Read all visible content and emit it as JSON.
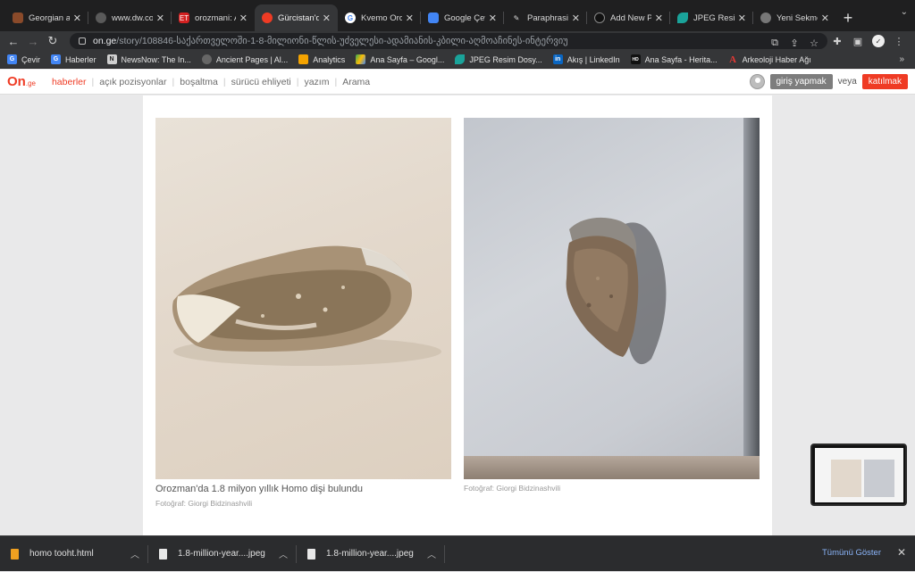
{
  "tabs": [
    {
      "title": "Georgian ar",
      "favicon_color": "#8a4a2a",
      "active": false
    },
    {
      "title": "www.dw.co",
      "favicon_color": "#5a5a5a",
      "active": false
    },
    {
      "title": "orozmani: A",
      "favicon_color": "#d32020",
      "favicon_text": "ET",
      "active": false
    },
    {
      "title": "Gürcistan'd",
      "favicon_color": "#ef3b24",
      "active": true
    },
    {
      "title": "Kvemo Oroz",
      "favicon_color": "#4285f4",
      "favicon_text": "G",
      "active": false
    },
    {
      "title": "Google Çevi",
      "favicon_color": "#4285f4",
      "active": false
    },
    {
      "title": "Paraphrasin",
      "favicon_color": "#444",
      "active": false
    },
    {
      "title": "Add New Po",
      "favicon_color": "#111",
      "active": false
    },
    {
      "title": "JPEG Resim",
      "favicon_color": "#1aa39a",
      "active": false
    },
    {
      "title": "Yeni Sekme",
      "favicon_color": "#666",
      "active": false
    }
  ],
  "address": {
    "host": "on.ge",
    "path": "/story/108846-საქართველოში-1-8-მილიონი-წლის-უძველესი-ადამიანის-კბილი-აღმოაჩინეს-ინტერვიუ"
  },
  "bookmarks": [
    {
      "label": "Çevir",
      "color": "#4285f4",
      "icon_text": "G"
    },
    {
      "label": "Haberler",
      "color": "#4285f4",
      "icon_text": "G"
    },
    {
      "label": "NewsNow: The In...",
      "color": "#d0d0d0",
      "icon_text": "N"
    },
    {
      "label": "Ancient Pages | Al...",
      "color": "#666",
      "icon_text": ""
    },
    {
      "label": "Analytics",
      "color": "#f4a300",
      "icon_text": ""
    },
    {
      "label": "Ana Sayfa – Googl...",
      "color": "#34a853",
      "icon_text": ""
    },
    {
      "label": "JPEG Resim Dosy...",
      "color": "#1aa39a",
      "icon_text": ""
    },
    {
      "label": "Akış | LinkedIn",
      "color": "#0a66c2",
      "icon_text": "in"
    },
    {
      "label": "Ana Sayfa - Herita...",
      "color": "#111",
      "icon_text": "HD"
    },
    {
      "label": "Arkeoloji Haber Ağı",
      "color": "#c62828",
      "icon_text": "A"
    }
  ],
  "site": {
    "logo": "On",
    "logo_suffix": ".ge",
    "nav": [
      "haberler",
      "açık pozisyonlar",
      "boşaltma",
      "sürücü ehliyeti",
      "yazım",
      "Arama"
    ],
    "login_label": "giriş yapmak",
    "or_label": "veya",
    "join_label": "katılmak"
  },
  "article": {
    "caption": "Orozman'da 1.8 milyon yıllık Homo dişi bulundu",
    "credit_left": "Fotoğraf: Giorgi Bidzinashvili",
    "credit_right": "Fotoğraf: Giorgi Bidzinashvili"
  },
  "downloads": [
    {
      "name": "homo tooht.html",
      "kind": "html"
    },
    {
      "name": "1.8-million-year....jpeg",
      "kind": "file"
    },
    {
      "name": "1.8-million-year....jpeg",
      "kind": "file"
    }
  ],
  "show_all_label": "Tümünü Göster"
}
